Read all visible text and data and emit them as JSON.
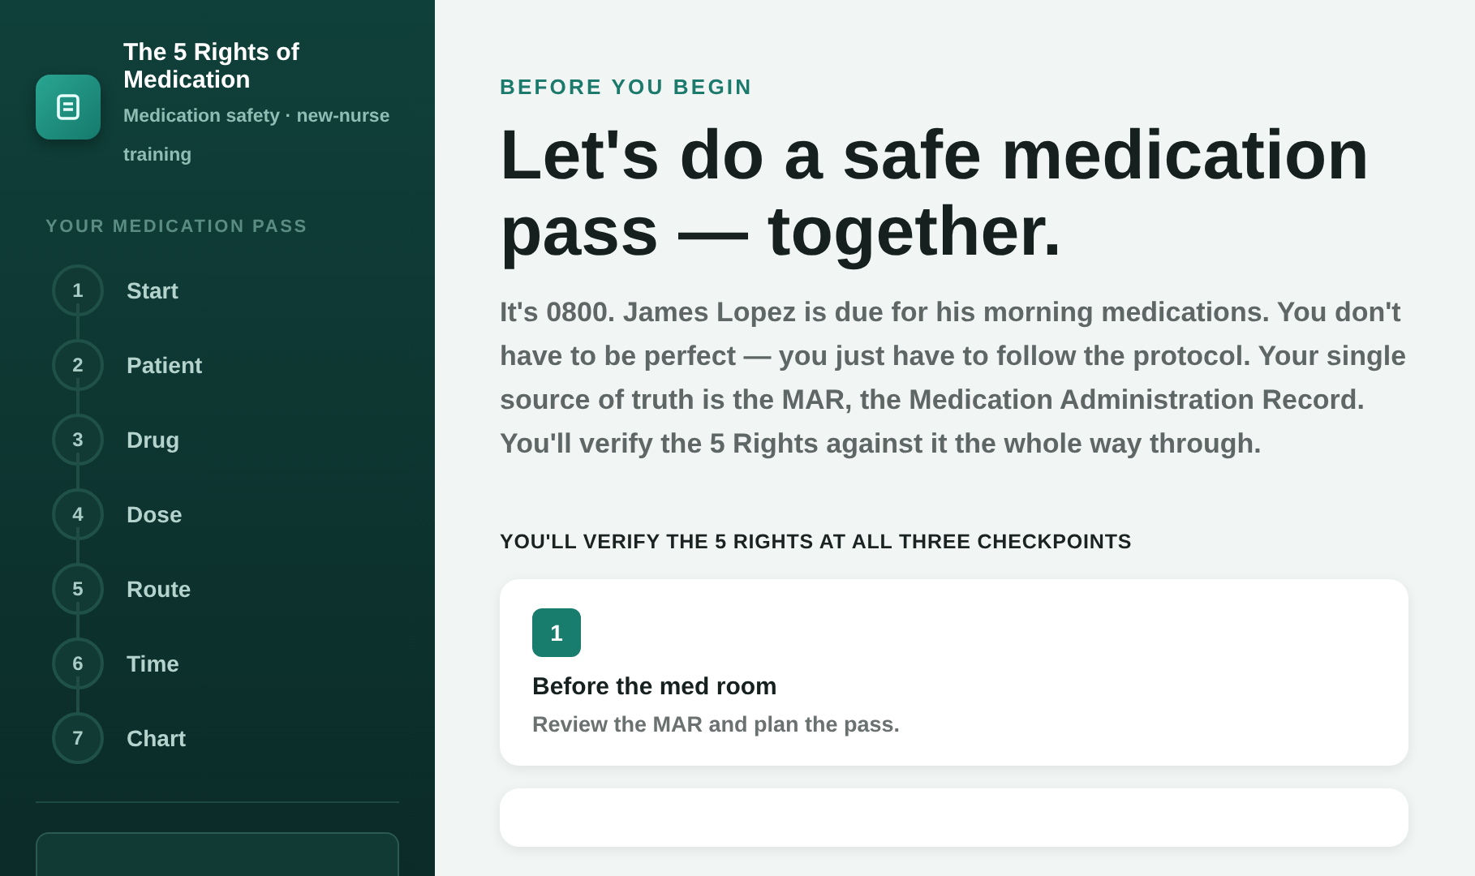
{
  "sidebar": {
    "title": "The 5 Rights of Medication",
    "subtitle": "Medication safety · new-nurse training",
    "section_label": "YOUR MEDICATION PASS",
    "steps": [
      {
        "number": "1",
        "label": "Start"
      },
      {
        "number": "2",
        "label": "Patient"
      },
      {
        "number": "3",
        "label": "Drug"
      },
      {
        "number": "4",
        "label": "Dose"
      },
      {
        "number": "5",
        "label": "Route"
      },
      {
        "number": "6",
        "label": "Time"
      },
      {
        "number": "7",
        "label": "Chart"
      }
    ]
  },
  "main": {
    "eyebrow": "BEFORE YOU BEGIN",
    "heading": "Let's do a safe medication pass — together.",
    "intro": "It's 0800. James Lopez is due for his morning medications. You don't have to be perfect — you just have to follow the protocol. Your single source of truth is the MAR, the Medication Administration Record. You'll verify the 5 Rights against it the whole way through.",
    "checkpoints_label": "YOU'LL VERIFY THE 5 RIGHTS AT ALL THREE CHECKPOINTS",
    "checkpoints": [
      {
        "number": "1",
        "title": "Before the med room",
        "description": "Review the MAR and plan the pass."
      }
    ]
  }
}
